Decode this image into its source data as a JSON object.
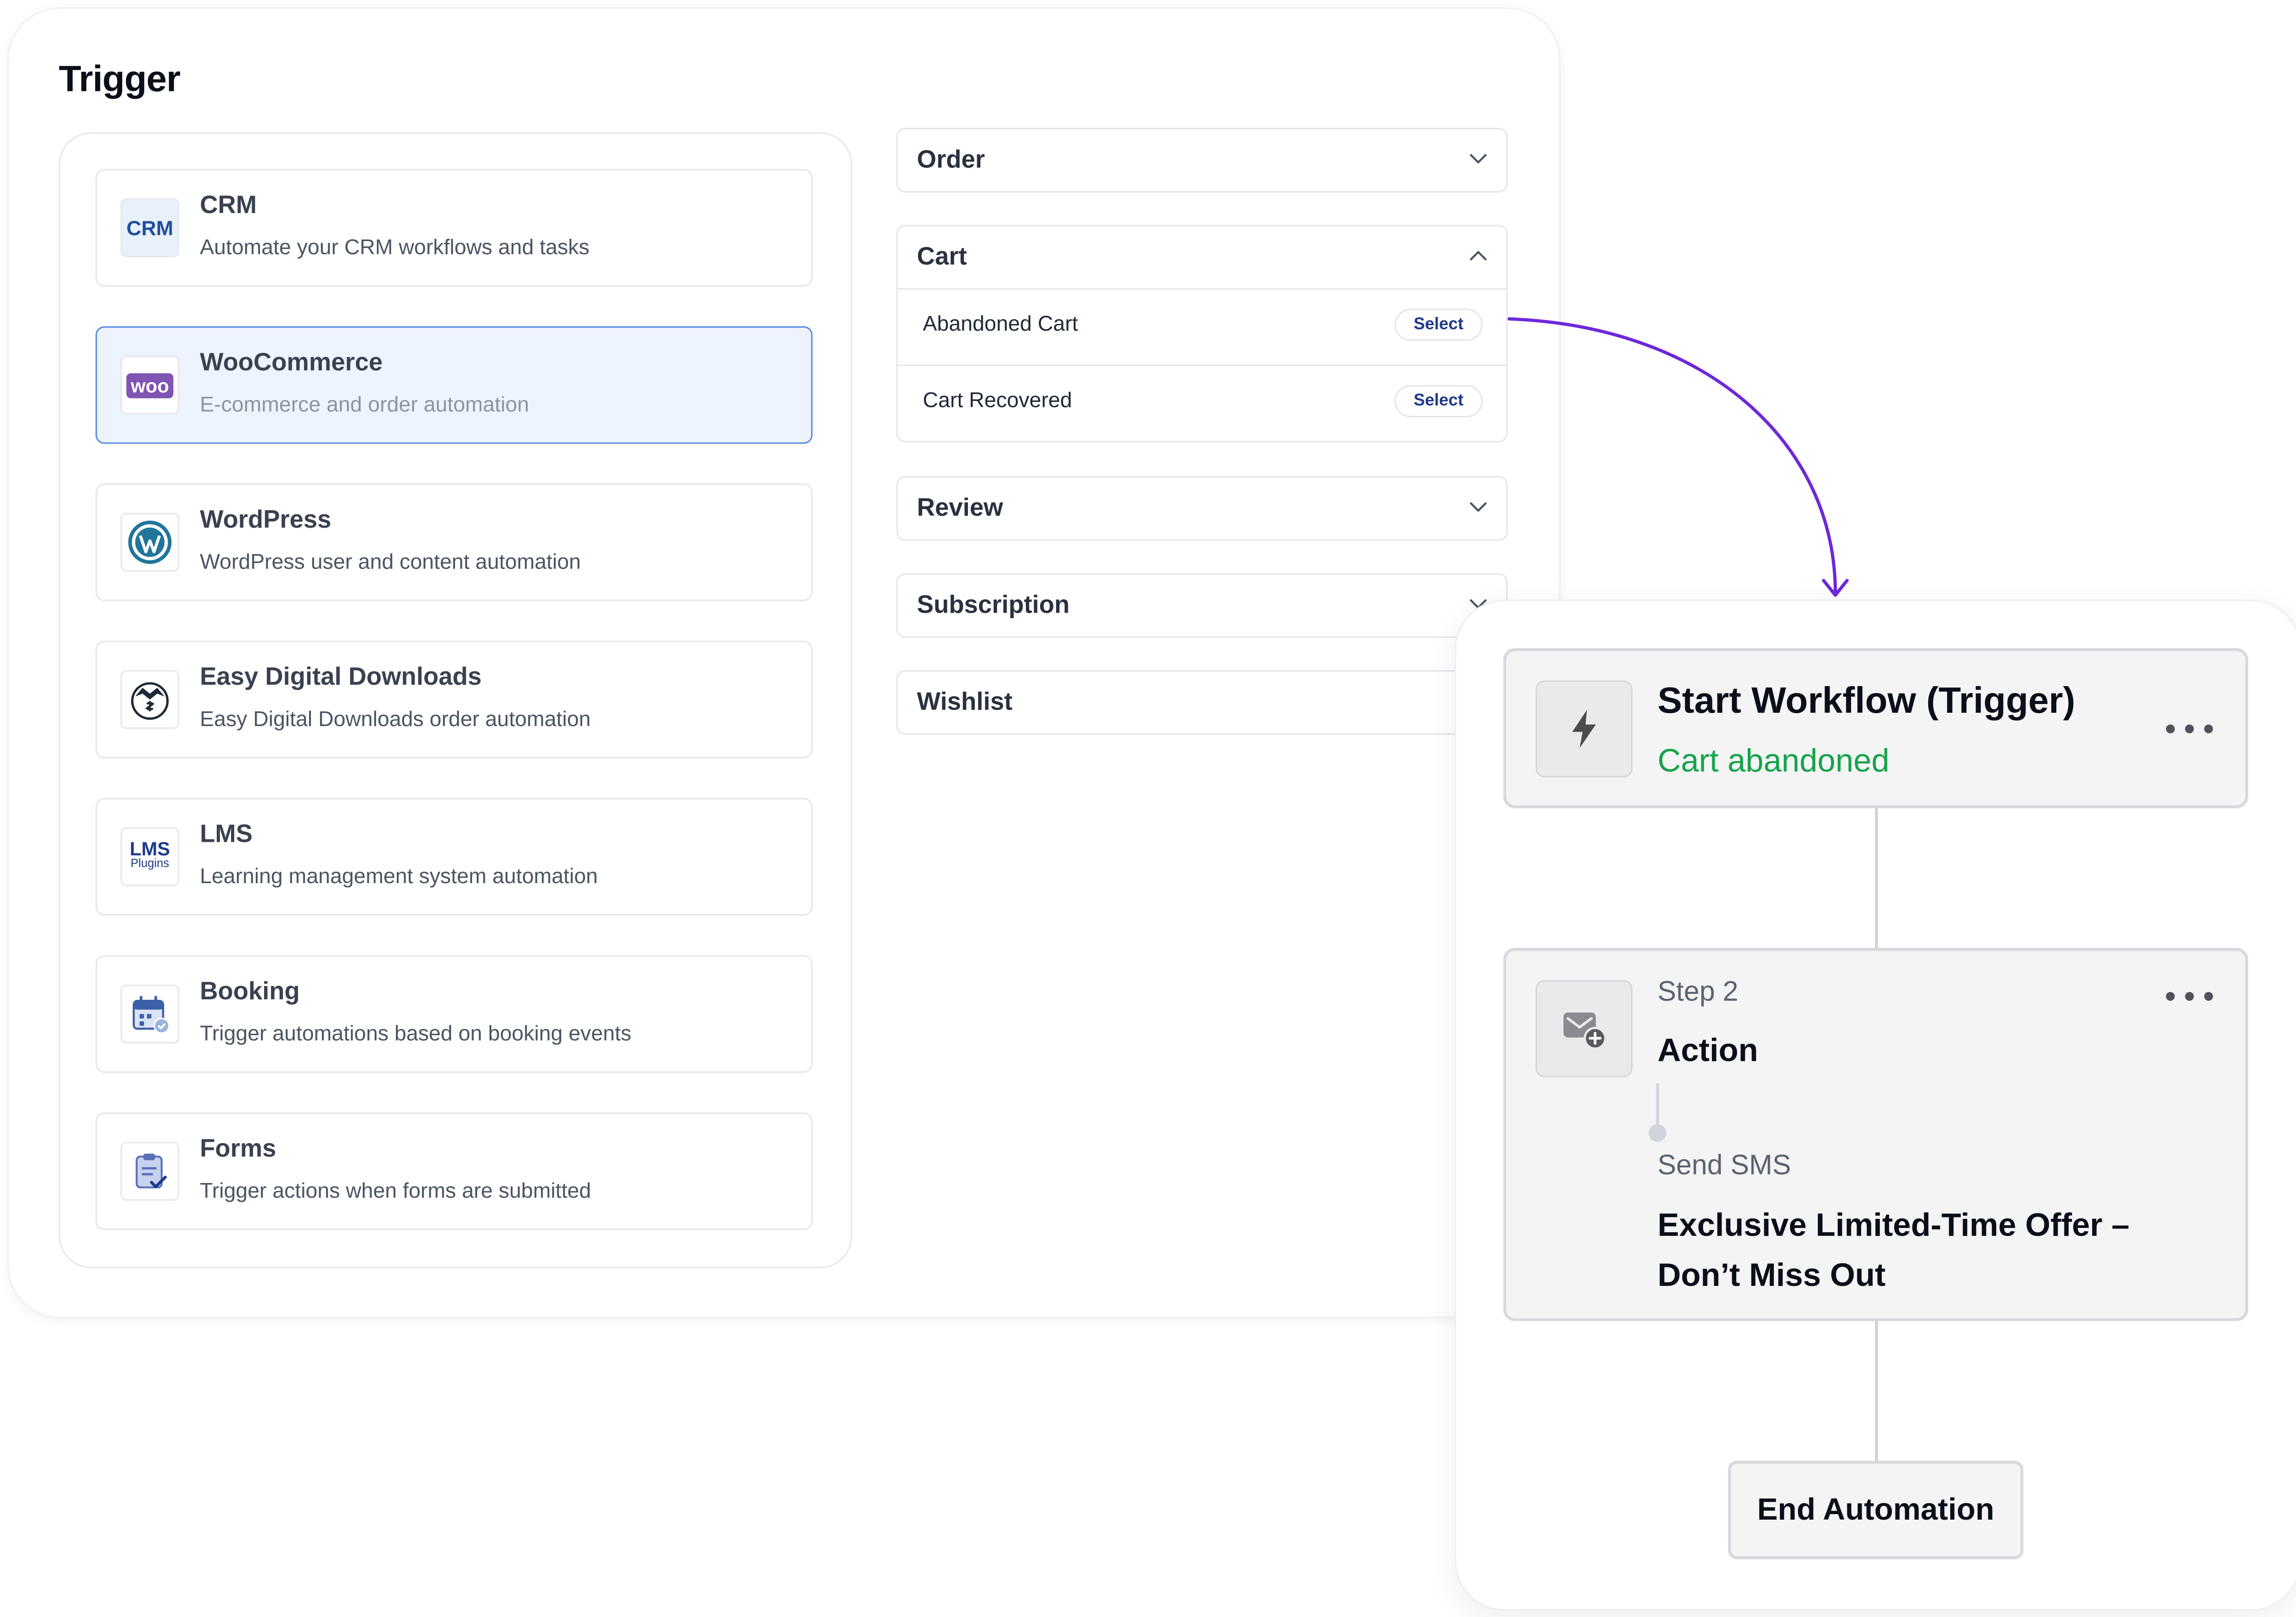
{
  "trigger_panel": {
    "title": "Trigger",
    "integrations": [
      {
        "title": "CRM",
        "description": "Automate your CRM workflows and tasks",
        "icon": "crm-logo-icon",
        "logo_text": "CRM",
        "selected": false
      },
      {
        "title": "WooCommerce",
        "description": "E-commerce and order automation",
        "icon": "woocommerce-logo-icon",
        "logo_text": "woo",
        "selected": true
      },
      {
        "title": "WordPress",
        "description": "WordPress user and content automation",
        "icon": "wordpress-logo-icon",
        "selected": false
      },
      {
        "title": "Easy Digital Downloads",
        "description": "Easy Digital Downloads order automation",
        "icon": "easy-digital-downloads-logo-icon",
        "selected": false
      },
      {
        "title": "LMS",
        "description": "Learning management system automation",
        "icon": "lms-plugins-logo-icon",
        "logo_text": "LMS",
        "logo_subtext": "Plugins",
        "selected": false
      },
      {
        "title": "Booking",
        "description": "Trigger automations based on booking events",
        "icon": "calendar-icon",
        "selected": false
      },
      {
        "title": "Forms",
        "description": "Trigger actions when forms are submitted",
        "icon": "clipboard-check-icon",
        "selected": false
      }
    ]
  },
  "categories": [
    {
      "label": "Order",
      "expanded": false
    },
    {
      "label": "Cart",
      "expanded": true,
      "options": [
        {
          "label": "Abandoned Cart",
          "button": "Select"
        },
        {
          "label": "Cart Recovered",
          "button": "Select"
        }
      ]
    },
    {
      "label": "Review",
      "expanded": false
    },
    {
      "label": "Subscription",
      "expanded": false
    },
    {
      "label": "Wishlist",
      "expanded": false
    }
  ],
  "workflow": {
    "trigger_card": {
      "title": "Start Workflow (Trigger)",
      "subtitle": "Cart abandoned",
      "icon": "lightning-bolt-icon"
    },
    "action_card": {
      "step_label": "Step 2",
      "title": "Action",
      "action_name": "Send SMS",
      "message": "Exclusive Limited-Time Offer – Don’t Miss Out",
      "icon": "message-add-icon"
    },
    "end_label": "End Automation"
  },
  "colors": {
    "accent_selected_border": "#5a8ee0",
    "accent_selected_bg": "#eef4fd",
    "connector_arrow": "#6d28d9",
    "success_text": "#16a34a",
    "select_button_text": "#1e3a8a"
  }
}
